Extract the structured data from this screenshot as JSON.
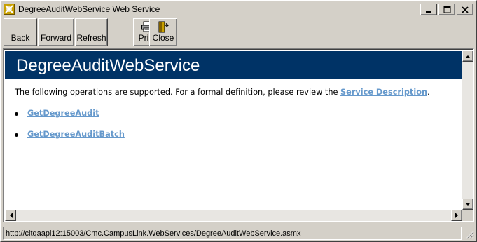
{
  "window": {
    "title": "DegreeAuditWebService Web Service",
    "icon": "web-service-app-icon"
  },
  "title_buttons": {
    "minimize_icon": "minimize-icon",
    "maximize_icon": "maximize-icon",
    "close_icon": "close-icon"
  },
  "toolbar": {
    "back_label": "Back",
    "forward_label": "Forward",
    "refresh_label": "Refresh",
    "print_label": "Print",
    "print_icon": "printer-icon",
    "close_label": "Close",
    "close_icon": "exit-door-icon"
  },
  "page": {
    "heading": "DegreeAuditWebService",
    "intro_prefix": "The following operations are supported. For a formal definition, please review the ",
    "intro_link": "Service Description",
    "intro_suffix": ".",
    "operations": [
      {
        "label": "GetDegreeAudit"
      },
      {
        "label": "GetDegreeAuditBatch"
      }
    ],
    "heading_bg": "#003366",
    "link_color": "#6699cc"
  },
  "status": {
    "text": "http://cltqaapi12:15003/Cmc.CampusLink.WebServices/DegreeAuditWebService.asmx"
  }
}
